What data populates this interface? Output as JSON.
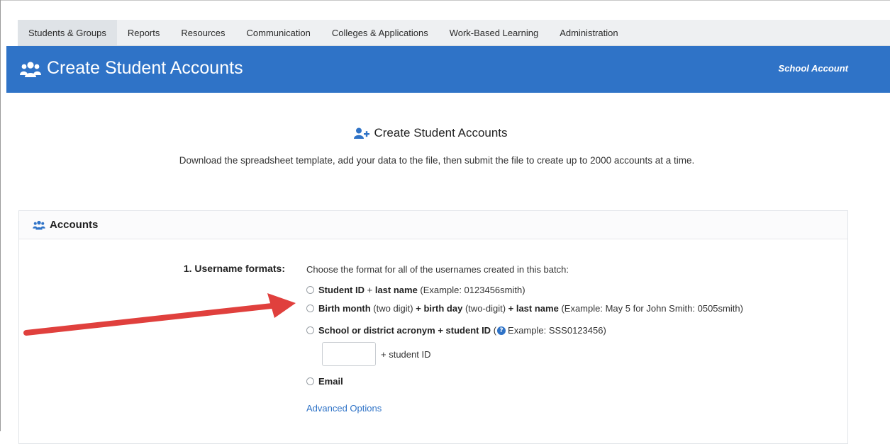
{
  "nav": {
    "items": [
      {
        "label": "Students & Groups",
        "active": true
      },
      {
        "label": "Reports"
      },
      {
        "label": "Resources"
      },
      {
        "label": "Communication"
      },
      {
        "label": "Colleges & Applications"
      },
      {
        "label": "Work-Based Learning"
      },
      {
        "label": "Administration"
      }
    ]
  },
  "header": {
    "icon": "users-icon",
    "title": "Create Student Accounts",
    "account_label": "School Account",
    "bg_color": "#2f73c7"
  },
  "intro": {
    "icon": "user-add-icon",
    "title": "Create Student Accounts",
    "description": "Download the spreadsheet template, add your data to the file, then submit the file to create up to 2000 accounts at a time."
  },
  "accounts": {
    "icon": "users-icon",
    "title": "Accounts",
    "username_label": "1. Username formats:",
    "username_desc": "Choose the format for all of the usernames created in this batch:",
    "options": [
      {
        "parts": [
          "Student ID",
          " + ",
          "last name",
          " (Example: 0123456smith)"
        ]
      },
      {
        "parts": [
          "Birth month",
          " (two digit) ",
          "+ birth day",
          " (two-digit) ",
          "+ last name",
          " (Example: May 5 for John Smith: 0505smith)"
        ]
      },
      {
        "parts": [
          "School or district acronym + student ID",
          " (",
          "Example: SSS0123456)"
        ]
      },
      {
        "parts": [
          "Email"
        ]
      }
    ],
    "acronym_value": "",
    "plus_student_id": "+ student ID",
    "advanced_options": "Advanced Options"
  },
  "annotation": {
    "arrow_color": "#e0403d"
  }
}
